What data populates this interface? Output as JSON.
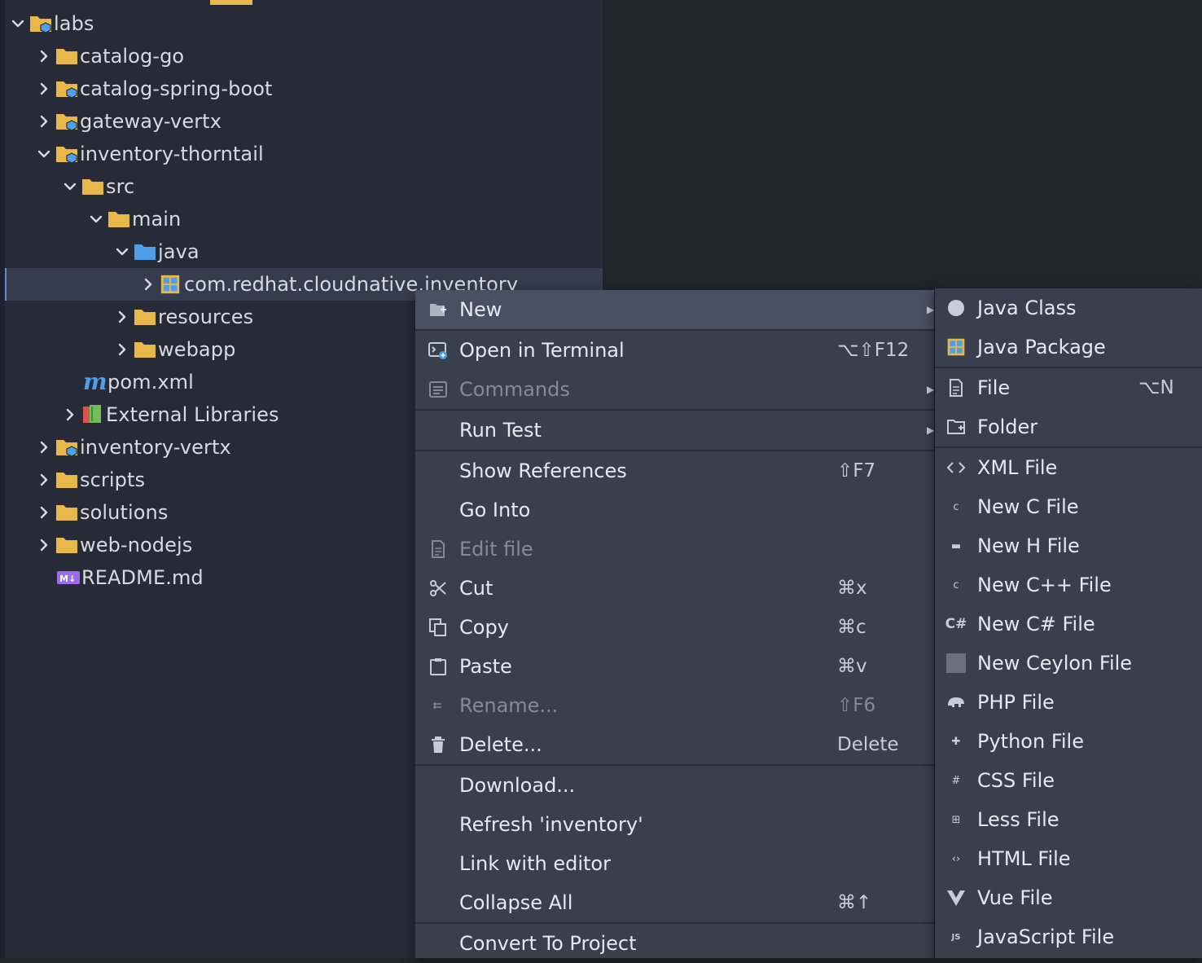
{
  "tree": {
    "items": [
      {
        "label": "labs",
        "icon": "project-folder-icon",
        "expanded": true
      },
      {
        "label": "catalog-go",
        "icon": "folder-icon",
        "expanded": false
      },
      {
        "label": "catalog-spring-boot",
        "icon": "project-folder-icon",
        "expanded": false
      },
      {
        "label": "gateway-vertx",
        "icon": "project-folder-icon",
        "expanded": false
      },
      {
        "label": "inventory-thorntail",
        "icon": "project-folder-icon",
        "expanded": true
      },
      {
        "label": "src",
        "icon": "folder-icon",
        "expanded": true
      },
      {
        "label": "main",
        "icon": "folder-icon",
        "expanded": true
      },
      {
        "label": "java",
        "icon": "source-folder-icon",
        "expanded": true
      },
      {
        "label": "com.redhat.cloudnative.inventory",
        "icon": "package-icon",
        "expanded": false,
        "selected": true
      },
      {
        "label": "resources",
        "icon": "folder-icon",
        "expanded": false
      },
      {
        "label": "webapp",
        "icon": "folder-icon",
        "expanded": false
      },
      {
        "label": "pom.xml",
        "icon": "maven-icon"
      },
      {
        "label": "External Libraries",
        "icon": "library-icon",
        "expanded": false
      },
      {
        "label": "inventory-vertx",
        "icon": "project-folder-icon",
        "expanded": false
      },
      {
        "label": "scripts",
        "icon": "folder-icon",
        "expanded": false
      },
      {
        "label": "solutions",
        "icon": "folder-icon",
        "expanded": false
      },
      {
        "label": "web-nodejs",
        "icon": "folder-icon",
        "expanded": false
      },
      {
        "label": "README.md",
        "icon": "markdown-icon"
      }
    ]
  },
  "context_menu": {
    "items": [
      {
        "label": "New",
        "icon": "new-icon",
        "submenu": true,
        "highlighted": true
      },
      {
        "label": "Open in Terminal",
        "icon": "terminal-icon",
        "shortcut": "⌥⇧F12"
      },
      {
        "label": "Commands",
        "icon": "commands-icon",
        "submenu": true,
        "disabled": true
      },
      {
        "label": "Run Test",
        "submenu": true
      },
      {
        "label": "Show References",
        "shortcut": "⇧F7"
      },
      {
        "label": "Go Into"
      },
      {
        "label": "Edit file",
        "icon": "edit-file-icon",
        "disabled": true
      },
      {
        "label": "Cut",
        "icon": "scissors-icon",
        "shortcut": "⌘x"
      },
      {
        "label": "Copy",
        "icon": "copy-icon",
        "shortcut": "⌘c"
      },
      {
        "label": "Paste",
        "icon": "paste-icon",
        "shortcut": "⌘v"
      },
      {
        "label": "Rename...",
        "icon": "rename-icon",
        "shortcut": "⇧F6",
        "disabled": true
      },
      {
        "label": "Delete...",
        "icon": "trash-icon",
        "shortcut": "Delete"
      },
      {
        "label": "Download..."
      },
      {
        "label": "Refresh 'inventory'"
      },
      {
        "label": "Link with editor"
      },
      {
        "label": "Collapse All",
        "shortcut": "⌘↑"
      },
      {
        "label": "Convert To Project"
      }
    ]
  },
  "new_submenu": {
    "items": [
      {
        "label": "Java Class",
        "icon": "java-class-icon"
      },
      {
        "label": "Java Package",
        "icon": "java-package-icon"
      },
      {
        "label": "File",
        "icon": "file-icon",
        "shortcut": "⌥N"
      },
      {
        "label": "Folder",
        "icon": "new-folder-icon"
      },
      {
        "label": "XML File",
        "icon": "xml-icon"
      },
      {
        "label": "New C File",
        "icon": "c-file-icon"
      },
      {
        "label": "New H File",
        "icon": "h-file-icon"
      },
      {
        "label": "New C++ File",
        "icon": "cpp-file-icon"
      },
      {
        "label": "New C# File",
        "icon": "csharp-file-icon"
      },
      {
        "label": "New Ceylon File",
        "icon": "ceylon-file-icon"
      },
      {
        "label": "PHP File",
        "icon": "php-file-icon"
      },
      {
        "label": "Python File",
        "icon": "python-file-icon"
      },
      {
        "label": "CSS File",
        "icon": "css-file-icon"
      },
      {
        "label": "Less File",
        "icon": "less-file-icon"
      },
      {
        "label": "HTML File",
        "icon": "html-file-icon"
      },
      {
        "label": "Vue File",
        "icon": "vue-file-icon"
      },
      {
        "label": "JavaScript File",
        "icon": "js-file-icon"
      }
    ]
  },
  "colors": {
    "folder": "#e8b84b",
    "source_folder": "#4f9fe8",
    "selection": "#353c4d",
    "menu_bg": "#3a3f4e",
    "menu_highlight": "#4a5063",
    "accent_tab": "#e8b84b"
  }
}
